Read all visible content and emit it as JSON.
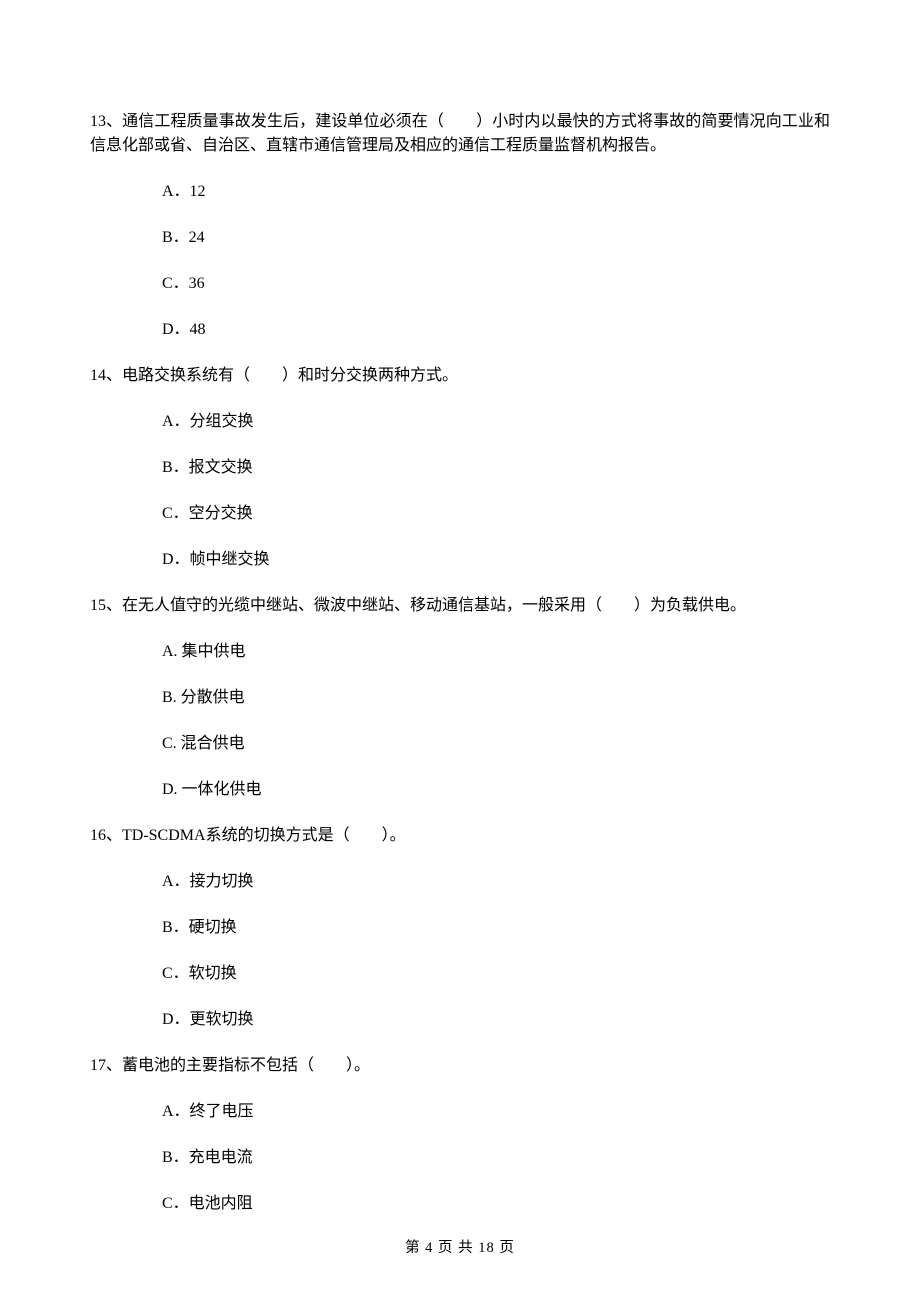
{
  "questions": [
    {
      "text": "13、通信工程质量事故发生后，建设单位必须在（　　）小时内以最快的方式将事故的简要情况向工业和信息化部或省、自治区、直辖市通信管理局及相应的通信工程质量监督机构报告。",
      "options": [
        "A．12",
        "B．24",
        "C．36",
        "D．48"
      ]
    },
    {
      "text": "14、电路交换系统有（　　）和时分交换两种方式。",
      "options": [
        "A．分组交换",
        "B．报文交换",
        "C．空分交换",
        "D．帧中继交换"
      ]
    },
    {
      "text": "15、在无人值守的光缆中继站、微波中继站、移动通信基站，一般采用（　　）为负载供电。",
      "options": [
        "A. 集中供电",
        "B. 分散供电",
        "C. 混合供电",
        "D. 一体化供电"
      ]
    },
    {
      "text": "16、TD-SCDMA系统的切换方式是（　　）。",
      "options": [
        "A．接力切换",
        "B．硬切换",
        "C．软切换",
        "D．更软切换"
      ]
    },
    {
      "text": "17、蓄电池的主要指标不包括（　　）。",
      "options": [
        "A．终了电压",
        "B．充电电流",
        "C．电池内阻"
      ]
    }
  ],
  "footer": "第 4 页 共 18 页"
}
